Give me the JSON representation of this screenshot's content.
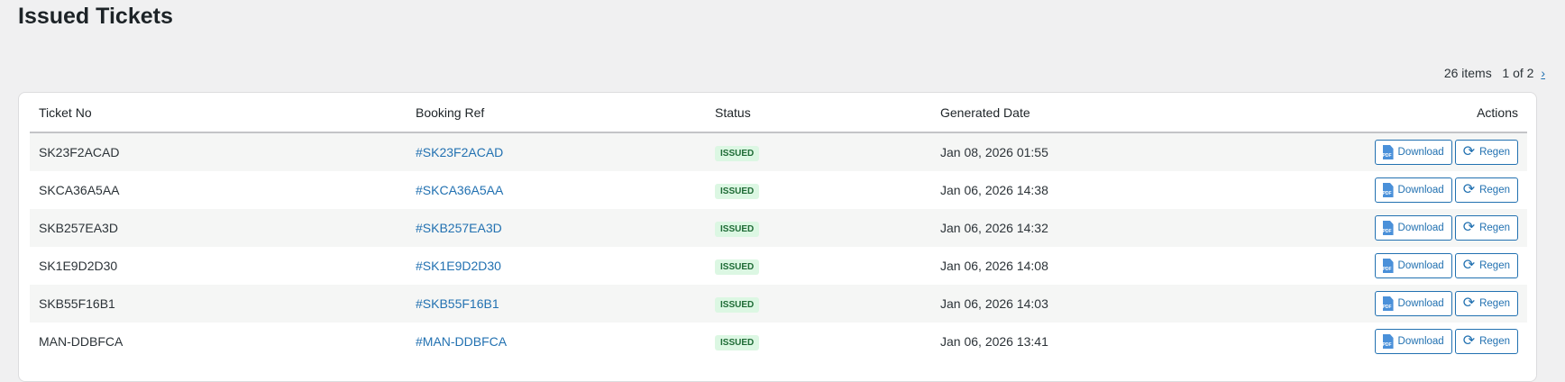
{
  "page_title": "Issued Tickets",
  "pagination": {
    "count": "26 items",
    "page": "1 of 2",
    "next": "›"
  },
  "columns": [
    "Ticket No",
    "Booking Ref",
    "Status",
    "Generated Date",
    "Actions"
  ],
  "actions": {
    "download": "Download",
    "regen": "Regen"
  },
  "rows": [
    {
      "ticket": "SK23F2ACAD",
      "ref": "#SK23F2ACAD",
      "status": "ISSUED",
      "date": "Jan 08, 2026 01:55"
    },
    {
      "ticket": "SKCA36A5AA",
      "ref": "#SKCA36A5AA",
      "status": "ISSUED",
      "date": "Jan 06, 2026 14:38"
    },
    {
      "ticket": "SKB257EA3D",
      "ref": "#SKB257EA3D",
      "status": "ISSUED",
      "date": "Jan 06, 2026 14:32"
    },
    {
      "ticket": "SK1E9D2D30",
      "ref": "#SK1E9D2D30",
      "status": "ISSUED",
      "date": "Jan 06, 2026 14:08"
    },
    {
      "ticket": "SKB55F16B1",
      "ref": "#SKB55F16B1",
      "status": "ISSUED",
      "date": "Jan 06, 2026 14:03"
    },
    {
      "ticket": "MAN-DDBFCA",
      "ref": "#MAN-DDBFCA",
      "status": "ISSUED",
      "date": "Jan 06, 2026 13:41"
    }
  ]
}
